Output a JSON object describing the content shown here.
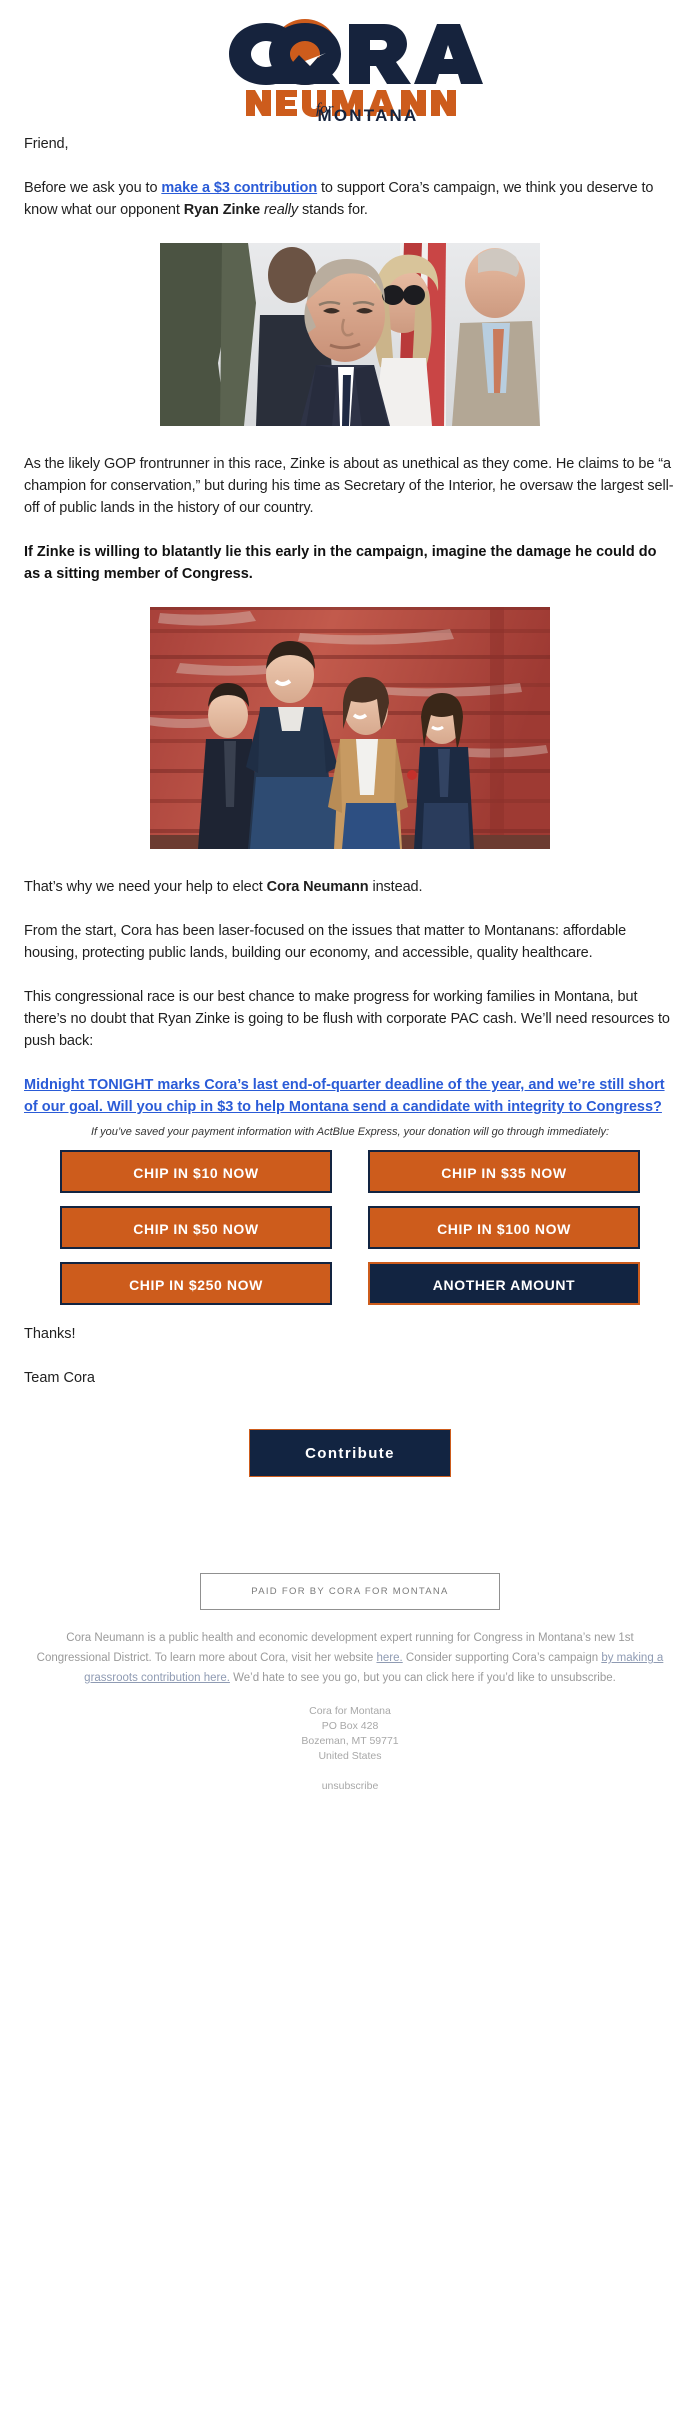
{
  "brand": {
    "logo_line1": "CORA",
    "logo_line2": "NEUMANN",
    "logo_for": "for",
    "logo_line3": "MONTANA",
    "navy": "#122441",
    "orange": "#cd5c1c",
    "link_blue": "#2a5bd7"
  },
  "letter": {
    "greeting": "Friend,",
    "p1_before": "Before we ask you to ",
    "p1_link": "make a $3 contribution",
    "p1_mid": " to support Cora’s campaign, we think you deserve to know what our opponent ",
    "p1_bold": "Ryan Zinke",
    "p1_italic": " really",
    "p1_after": " stands for.",
    "p2": "As the likely GOP frontrunner in this race, Zinke is about as unethical as they come. He claims to be “a champion for conservation,” but during his time as Secretary of the Interior, he oversaw the largest sell-off of public lands in the history of our country.",
    "p3_bold": "If Zinke is willing to blatantly lie this early in the campaign, imagine the damage he could do as a sitting member of Congress.",
    "p4_before": "That’s why we need your help to elect ",
    "p4_bold": "Cora Neumann",
    "p4_after": " instead.",
    "p5": "From the start, Cora has been laser-focused on the issues that matter to Montanans: affordable housing, protecting public lands, building our economy, and accessible, quality healthcare.",
    "p6": "This congressional race is our best chance to make progress for working families in Montana, but there’s no doubt that Ryan Zinke is going to be flush with corporate PAC cash. We’ll need resources to push back:",
    "p7_link": "Midnight TONIGHT marks Cora’s last end-of-quarter deadline of the year, and we’re still short of our goal. Will you chip in $3 to help Montana send a candidate with integrity to Congress?",
    "thanks": "Thanks!",
    "team": "Team Cora"
  },
  "images": {
    "zinke_alt": "Ryan Zinke standing in a crowd with an American flag behind",
    "family_alt": "Cora Neumann with her family in front of a red barn"
  },
  "donate": {
    "actblue_note": "If you’ve saved your payment information with ActBlue Express, your donation will go through immediately:",
    "buttons": [
      {
        "label": "CHIP IN $10 NOW",
        "style": "orange"
      },
      {
        "label": "CHIP IN $35 NOW",
        "style": "orange"
      },
      {
        "label": "CHIP IN $50 NOW",
        "style": "orange"
      },
      {
        "label": "CHIP IN $100 NOW",
        "style": "orange"
      },
      {
        "label": "CHIP IN $250 NOW",
        "style": "orange"
      },
      {
        "label": "ANOTHER AMOUNT",
        "style": "navy"
      }
    ],
    "contribute_label": "Contribute"
  },
  "footer": {
    "paid_for": "PAID FOR BY CORA FOR MONTANA",
    "disclaimer_1": "Cora Neumann is a public health and economic development expert running for Congress in Montana’s new 1st Congressional District. To learn more about Cora, visit her website ",
    "disclaimer_link_1": "here.",
    "disclaimer_2": " Consider supporting Cora’s campaign ",
    "disclaimer_link_2": "by making a grassroots contribution here.",
    "disclaimer_3": " We’d hate to see you go, but you can click here if you’d like to unsubscribe.",
    "address_1": "Cora for Montana",
    "address_2": "PO Box 428",
    "address_3": "Bozeman, MT 59771",
    "address_4": "United States",
    "unsubscribe": "unsubscribe"
  }
}
